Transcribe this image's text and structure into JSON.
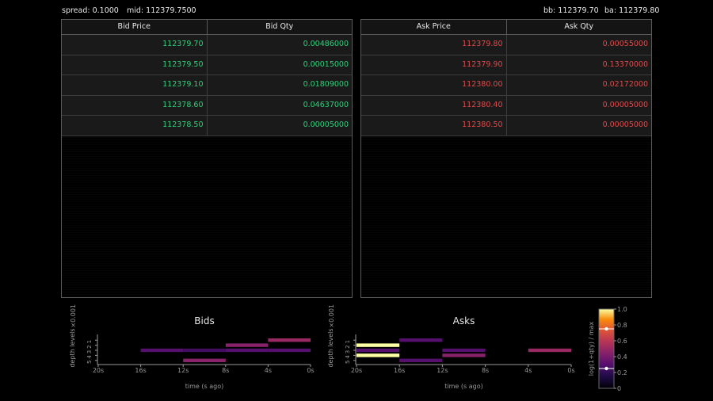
{
  "header": {
    "spread": "spread: 0.1000",
    "mid": "mid: 112379.7500",
    "bb": "bb: 112379.70",
    "ba": "ba: 112379.80"
  },
  "bids_table": {
    "columns": [
      "Bid Price",
      "Bid Qty"
    ],
    "rows": [
      [
        "112379.70",
        "0.00486000"
      ],
      [
        "112379.50",
        "0.00015000"
      ],
      [
        "112379.10",
        "0.01809000"
      ],
      [
        "112378.60",
        "0.04637000"
      ],
      [
        "112378.50",
        "0.00005000"
      ]
    ]
  },
  "asks_table": {
    "columns": [
      "Ask Price",
      "Ask Qty"
    ],
    "rows": [
      [
        "112379.80",
        "0.00055000"
      ],
      [
        "112379.90",
        "0.13370000"
      ],
      [
        "112380.00",
        "0.02172000"
      ],
      [
        "112380.40",
        "0.00005000"
      ],
      [
        "112380.50",
        "0.00005000"
      ]
    ]
  },
  "colors": {
    "bid": "#2fd07a",
    "ask": "#e24a4a",
    "background": "#000000"
  },
  "chart_data": [
    {
      "type": "heatmap",
      "title": "Bids",
      "xlabel": "time (s ago)",
      "ylabel": "depth levels",
      "offset_label": "×0.001",
      "x_ticks": [
        "20s",
        "16s",
        "12s",
        "8s",
        "4s",
        "0s"
      ],
      "y_ticks": [
        "1",
        "2",
        "3",
        "4",
        "5"
      ],
      "cells": [
        {
          "t0": 16,
          "t1": 12,
          "level": 2,
          "value": 0.3
        },
        {
          "t0": 12,
          "t1": 8,
          "level": 2,
          "value": 0.25
        },
        {
          "t0": 12,
          "t1": 8,
          "level": 4,
          "value": 0.45
        },
        {
          "t0": 8,
          "t1": 4,
          "level": 1,
          "value": 0.45
        },
        {
          "t0": 8,
          "t1": 4,
          "level": 2,
          "value": 0.3
        },
        {
          "t0": 4,
          "t1": 0,
          "level": 0,
          "value": 0.5
        },
        {
          "t0": 4,
          "t1": 0,
          "level": 2,
          "value": 0.3
        }
      ]
    },
    {
      "type": "heatmap",
      "title": "Asks",
      "xlabel": "time (s ago)",
      "ylabel": "depth levels",
      "offset_label": "×0.001",
      "x_ticks": [
        "20s",
        "16s",
        "12s",
        "8s",
        "4s",
        "0s"
      ],
      "y_ticks": [
        "1",
        "2",
        "3",
        "4",
        "5"
      ],
      "cells": [
        {
          "t0": 20,
          "t1": 16,
          "level": 1,
          "value": 1.0
        },
        {
          "t0": 20,
          "t1": 16,
          "level": 2,
          "value": 0.3
        },
        {
          "t0": 20,
          "t1": 16,
          "level": 3,
          "value": 1.0
        },
        {
          "t0": 16,
          "t1": 12,
          "level": 0,
          "value": 0.3
        },
        {
          "t0": 16,
          "t1": 12,
          "level": 4,
          "value": 0.3
        },
        {
          "t0": 12,
          "t1": 8,
          "level": 2,
          "value": 0.3
        },
        {
          "t0": 12,
          "t1": 8,
          "level": 3,
          "value": 0.45
        },
        {
          "t0": 4,
          "t1": 0,
          "level": 2,
          "value": 0.5
        }
      ]
    }
  ],
  "colorbar": {
    "label": "log(1+qty) / max",
    "ticks": [
      "0",
      "0.2",
      "0.4",
      "0.6",
      "0.8",
      "1.0"
    ],
    "handles": [
      0.75,
      0.25
    ]
  }
}
